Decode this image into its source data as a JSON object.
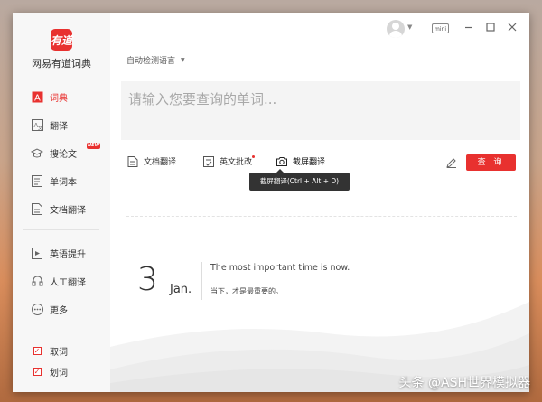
{
  "app": {
    "name": "网易有道词典",
    "logo_text": "有道"
  },
  "sidebar": {
    "items": [
      {
        "label": "词典"
      },
      {
        "label": "翻译"
      },
      {
        "label": "搜论文",
        "badge": "NEW"
      },
      {
        "label": "单词本"
      },
      {
        "label": "文档翻译"
      },
      {
        "label": "英语提升"
      },
      {
        "label": "人工翻译"
      },
      {
        "label": "更多"
      }
    ],
    "checks": [
      {
        "label": "取词",
        "checked": true
      },
      {
        "label": "划词",
        "checked": true
      }
    ]
  },
  "titlebar": {
    "mini_label": "mini"
  },
  "main": {
    "language_select": "自动检测语言",
    "search_placeholder": "请输入您要查询的单词...",
    "tools": {
      "doc_translate": "文档翻译",
      "english_grading": "英文批改",
      "screenshot_translate": "截屏翻译"
    },
    "tooltip": "截屏翻译(Ctrl + Alt + D)",
    "query_button": "查 询",
    "daily": {
      "day": "3",
      "month": "Jan.",
      "quote_en": "The most important time is now.",
      "quote_zh": "当下，才是最重要的。"
    }
  },
  "watermark": "头条 @ASH世界模拟器",
  "colors": {
    "accent": "#e8312f",
    "sidebar_bg": "#f7f7f7",
    "search_bg": "#f4f4f4"
  }
}
